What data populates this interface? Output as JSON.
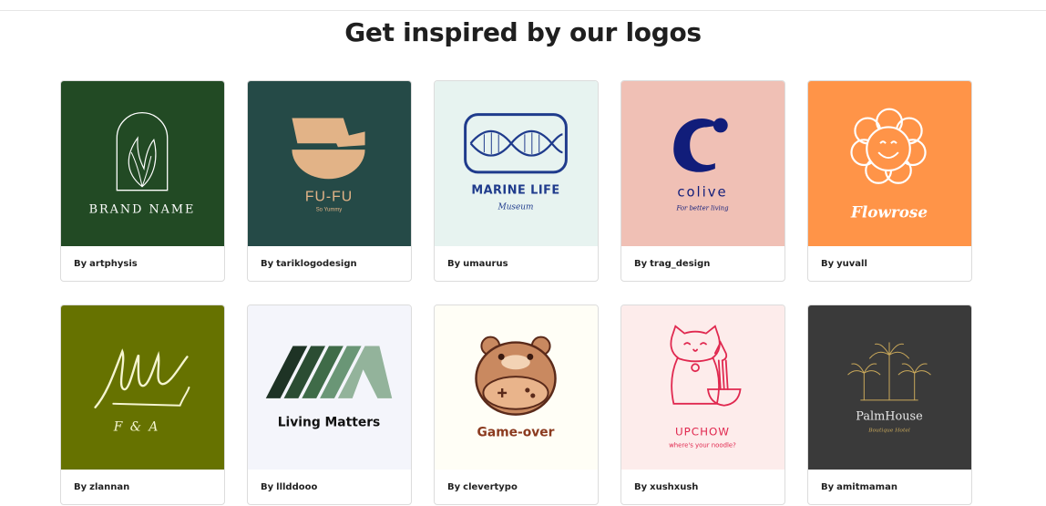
{
  "page": {
    "title": "Get inspired by our logos"
  },
  "cards": [
    {
      "by": "By",
      "author": "artphysis",
      "logo_text": "BRAND NAME",
      "bg": "#224a24"
    },
    {
      "by": "By",
      "author": "tariklogodesign",
      "logo_text": "FU-FU",
      "logo_sub": "So Yummy",
      "bg": "#254a47"
    },
    {
      "by": "By",
      "author": "umaurus",
      "logo_text": "MARINE LIFE",
      "logo_sub": "Museum",
      "bg": "#e7f3f0"
    },
    {
      "by": "By",
      "author": "trag_design",
      "logo_text": "colive",
      "logo_sub": "For better living",
      "bg": "#f0c0b5"
    },
    {
      "by": "By",
      "author": "yuvall",
      "logo_text": "Flowrose",
      "bg": "#ff9448"
    },
    {
      "by": "By",
      "author": "zlannan",
      "logo_text": "F & A",
      "bg": "#667200"
    },
    {
      "by": "By",
      "author": "lllddooo",
      "logo_text": "Living Matters",
      "bg": "#f4f5fb"
    },
    {
      "by": "By",
      "author": "clevertypo",
      "logo_text": "Game-over",
      "bg": "#fffef6"
    },
    {
      "by": "By",
      "author": "xushxush",
      "logo_text": "UPCHOW",
      "logo_sub": "where's your noodle?",
      "bg": "#fdeceb"
    },
    {
      "by": "By",
      "author": "amitmaman",
      "logo_text": "PalmHouse",
      "logo_sub": "Boutique Hotel",
      "bg": "#3a3a3a"
    }
  ]
}
